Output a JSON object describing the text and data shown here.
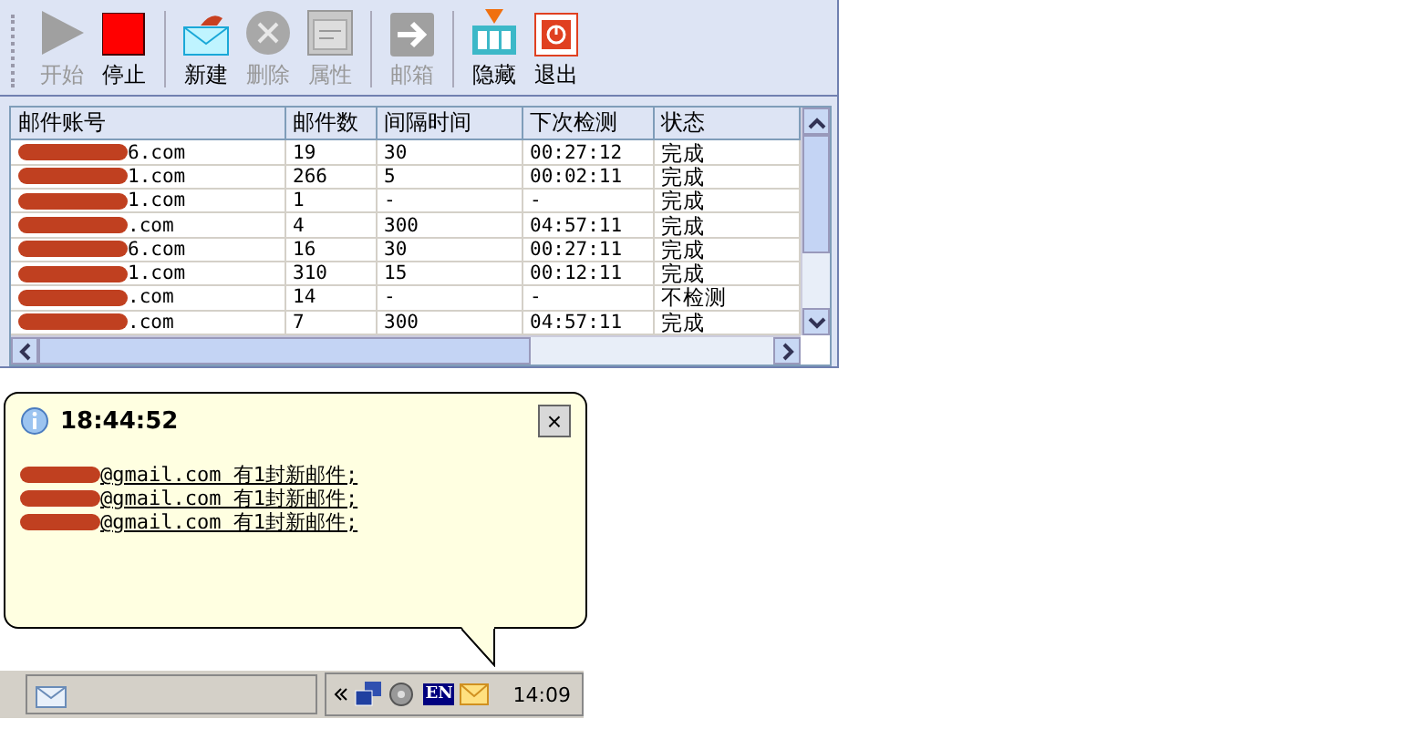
{
  "toolbar": [
    {
      "label": "开始",
      "kind": "play",
      "disabled": true
    },
    {
      "label": "停止",
      "kind": "stop",
      "disabled": false
    },
    {
      "label": "新建",
      "kind": "mail",
      "disabled": false
    },
    {
      "label": "删除",
      "kind": "delete",
      "disabled": true
    },
    {
      "label": "属性",
      "kind": "window",
      "disabled": true
    },
    {
      "label": "邮箱",
      "kind": "arrow",
      "disabled": true
    },
    {
      "label": "隐藏",
      "kind": "columns",
      "disabled": false
    },
    {
      "label": "退出",
      "kind": "power",
      "disabled": false
    }
  ],
  "table": {
    "columns": [
      "邮件账号",
      "邮件数",
      "间隔时间",
      "下次检测",
      "状态"
    ],
    "rows": [
      [
        "6.com",
        "19",
        "30",
        "00:27:12",
        "完成"
      ],
      [
        "1.com",
        "266",
        "5",
        "00:02:11",
        "完成"
      ],
      [
        "1.com",
        "1",
        "-",
        "-",
        "完成"
      ],
      [
        ".com",
        "4",
        "300",
        "04:57:11",
        "完成"
      ],
      [
        "6.com",
        "16",
        "30",
        "00:27:11",
        "完成"
      ],
      [
        "1.com",
        "310",
        "15",
        "00:12:11",
        "完成"
      ],
      [
        ".com",
        "14",
        "-",
        "-",
        "不检测"
      ],
      [
        ".com",
        "7",
        "300",
        "04:57:11",
        "完成"
      ]
    ]
  },
  "notification": {
    "time": "18:44:52",
    "close": "×",
    "lines": [
      "@gmail.com 有1封新邮件;",
      "@gmail.com 有1封新邮件;",
      "@gmail.com 有1封新邮件;"
    ]
  },
  "taskbar": {
    "language": "EN",
    "clock": "14:09"
  }
}
